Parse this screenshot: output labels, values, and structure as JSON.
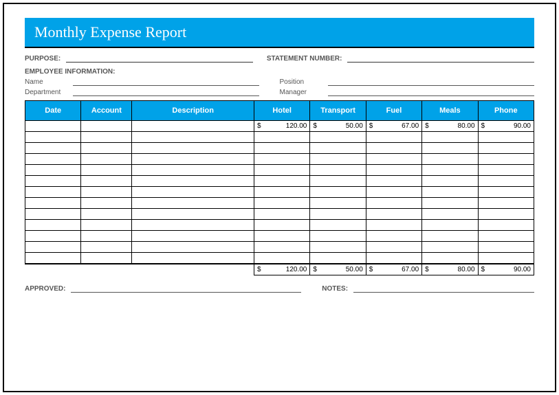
{
  "title": "Monthly Expense Report",
  "labels": {
    "purpose": "PURPOSE:",
    "statement_number": "STATEMENT NUMBER:",
    "employee_info": "EMPLOYEE INFORMATION:",
    "name": "Name",
    "position": "Position",
    "department": "Department",
    "manager": "Manager",
    "approved": "APPROVED:",
    "notes": "NOTES:"
  },
  "columns": {
    "date": "Date",
    "account": "Account",
    "description": "Description",
    "hotel": "Hotel",
    "transport": "Transport",
    "fuel": "Fuel",
    "meals": "Meals",
    "phone": "Phone"
  },
  "currency": "$",
  "data_row": {
    "hotel": "120.00",
    "transport": "50.00",
    "fuel": "67.00",
    "meals": "80.00",
    "phone": "90.00"
  },
  "totals": {
    "hotel": "120.00",
    "transport": "50.00",
    "fuel": "67.00",
    "meals": "80.00",
    "phone": "90.00"
  },
  "chart_data": {
    "type": "table",
    "title": "Monthly Expense Report",
    "columns": [
      "Date",
      "Account",
      "Description",
      "Hotel",
      "Transport",
      "Fuel",
      "Meals",
      "Phone"
    ],
    "rows": [
      [
        "",
        "",
        "",
        120.0,
        50.0,
        67.0,
        80.0,
        90.0
      ]
    ],
    "totals": {
      "Hotel": 120.0,
      "Transport": 50.0,
      "Fuel": 67.0,
      "Meals": 80.0,
      "Phone": 90.0
    },
    "currency": "USD"
  }
}
